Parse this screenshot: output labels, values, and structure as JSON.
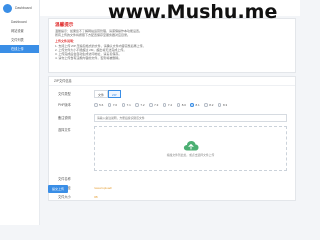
{
  "sidebar": {
    "brand": "Dashboard",
    "items": [
      {
        "label": "Dashboard"
      },
      {
        "label": "网站设置"
      },
      {
        "label": "文件列表"
      },
      {
        "label": "在线上传"
      }
    ]
  },
  "watermark": "www.Mushu.me",
  "notice": {
    "title": "温馨提示",
    "lines": [
      "温馨提示：如果您不了解网站运营管理，请谨慎操作本功能设置。",
      "所有上传的文件将按照下方配置保存至服务器对应目录。"
    ],
    "subtitle": "上传文件说明：",
    "items": [
      "1. 支持上传 ZIP 压缩包格式的文件，请确认文件内容完整后再上传。",
      "2. 上传文件大小不能超过 2M，超出将无法完成上传。",
      "3. 上传完成后会自动生成访问地址，请妥善保存。",
      "4. 请勿上传含有违规内容的文件，否则将被删除。"
    ]
  },
  "form": {
    "section_title": "ZIP文件信息",
    "type_label": "文件类型",
    "type_options": [
      "文件",
      "ZIP"
    ],
    "php_label": "PHP版本",
    "php_versions": [
      "5.6",
      "7.0",
      "7.1",
      "7.2",
      "7.3",
      "7.4",
      "8.0",
      "8.1",
      "8.2",
      "8.3"
    ],
    "php_selected_index": 7,
    "remark_label": "备注说明",
    "remark_placeholder": "请输入备注说明，方便后续识别该文件",
    "file_label": "选择文件",
    "upload_hint": "拖拽文件到此处，或点击选择文件上传",
    "name_label": "文件名称",
    "name_value": "",
    "path_label": "文件路径",
    "path_value": "/www/upload/",
    "size_label": "文件大小",
    "size_value": "0B",
    "submit_label": "提交上传"
  },
  "colors": {
    "accent": "#3a8ee6",
    "danger": "#e03131",
    "warning": "#e6a23c"
  }
}
